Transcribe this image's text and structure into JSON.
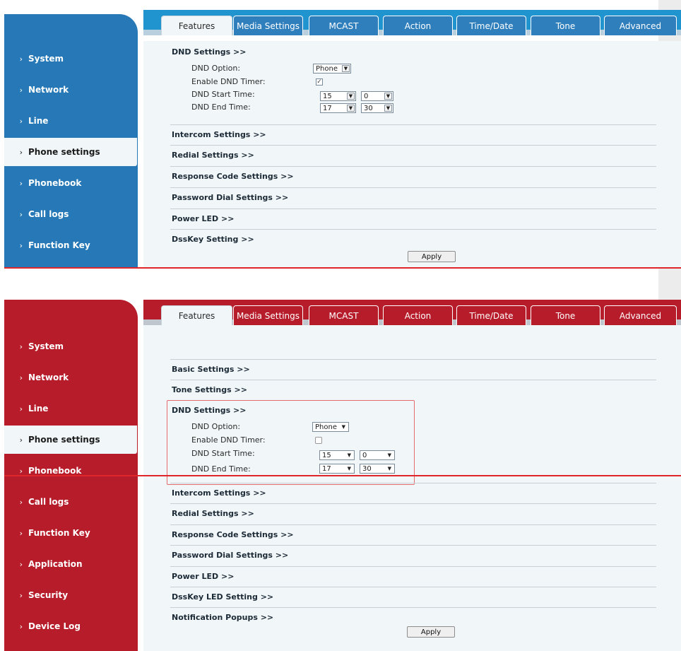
{
  "tabs": [
    "Features",
    "Media Settings",
    "MCAST",
    "Action",
    "Time/Date",
    "Tone",
    "Advanced"
  ],
  "panel_top": {
    "nav": [
      "System",
      "Network",
      "Line",
      "Phone settings",
      "Phonebook",
      "Call logs",
      "Function Key"
    ],
    "active_nav": "Phone settings",
    "active_tab": "Features",
    "dnd": {
      "title": "DND Settings >>",
      "option_label": "DND Option:",
      "option_value": "Phone",
      "timer_label": "Enable DND Timer:",
      "timer_checked": true,
      "start_label": "DND Start Time:",
      "start_hour": "15",
      "start_min": "0",
      "end_label": "DND End Time:",
      "end_hour": "17",
      "end_min": "30"
    },
    "sections": [
      "Intercom Settings >>",
      "Redial Settings >>",
      "Response Code Settings >>",
      "Password Dial Settings >>",
      "Power LED >>",
      "DssKey Setting >>"
    ],
    "apply_label": "Apply",
    "theme_color": "#2679b6"
  },
  "panel_bottom": {
    "nav": [
      "System",
      "Network",
      "Line",
      "Phone settings",
      "Phonebook",
      "Call logs",
      "Function Key",
      "Application",
      "Security",
      "Device Log"
    ],
    "active_nav": "Phone settings",
    "active_tab": "Features",
    "sections_before": [
      "Basic Settings >>",
      "Tone Settings >>"
    ],
    "dnd": {
      "title": "DND Settings >>",
      "option_label": "DND Option:",
      "option_value": "Phone",
      "timer_label": "Enable DND Timer:",
      "timer_checked": false,
      "start_label": "DND Start Time:",
      "start_hour": "15",
      "start_min": "0",
      "end_label": "DND End Time:",
      "end_hour": "17",
      "end_min": "30"
    },
    "sections_after": [
      "Intercom Settings >>",
      "Redial Settings >>",
      "Response Code Settings >>",
      "Password Dial Settings >>",
      "Power LED >>",
      "DssKey LED Setting >>",
      "Notification Popups >>"
    ],
    "apply_label": "Apply",
    "theme_color": "#b71c2a"
  },
  "colors": {
    "divider_red": "#e0262a",
    "highlight_box": "#e36b6b"
  }
}
